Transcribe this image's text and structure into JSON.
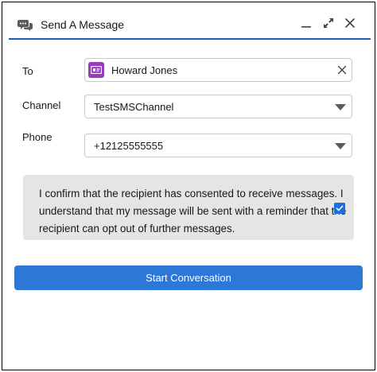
{
  "header": {
    "title": "Send A Message",
    "icons": {
      "app": "chat-bubbles-icon",
      "minimize": "minimize-icon",
      "expand": "expand-icon",
      "close": "close-icon"
    }
  },
  "form": {
    "to": {
      "label": "To",
      "value": "Howard Jones",
      "icon": "contact-card-icon",
      "clear_icon": "clear-icon"
    },
    "channel": {
      "label": "Channel",
      "value": "TestSMSChannel"
    },
    "phone": {
      "label": "Phone",
      "value": "+12125555555"
    }
  },
  "consent": {
    "text": "I confirm that the recipient has consented to receive messages. I understand that my message will be sent with a reminder that the recipient can opt out of further messages.",
    "checked": true
  },
  "actions": {
    "start_label": "Start Conversation"
  },
  "colors": {
    "accent": "#2d77d6",
    "header_rule": "#1b5eb9",
    "contact_icon_bg": "#963cbd",
    "consent_bg": "#e5e5e5"
  }
}
